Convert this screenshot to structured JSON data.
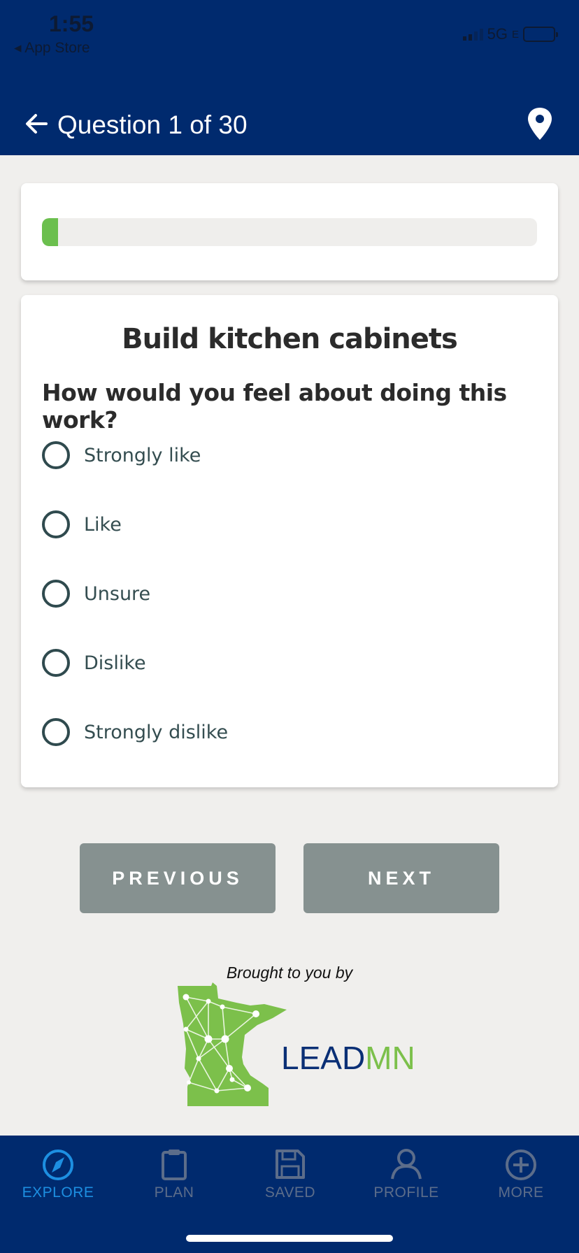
{
  "status_bar": {
    "time": "1:55",
    "back_app": "App Store",
    "network": "5G",
    "network_suffix": "E"
  },
  "header": {
    "title": "Question 1 of 30",
    "back_icon": "arrow-left-icon",
    "location_icon": "map-pin-icon"
  },
  "progress": {
    "value": 0.033
  },
  "question": {
    "title": "Build kitchen cabinets",
    "prompt": "How would you feel about doing this work?",
    "options": [
      "Strongly like",
      "Like",
      "Unsure",
      "Dislike",
      "Strongly dislike"
    ]
  },
  "nav": {
    "previous": "PREVIOUS",
    "next": "NEXT"
  },
  "sponsor": {
    "brought_by": "Brought to you by",
    "lead": "LEAD",
    "mn": "MN"
  },
  "tabs": [
    {
      "label": "EXPLORE",
      "icon": "compass-icon",
      "active": true
    },
    {
      "label": "PLAN",
      "icon": "clipboard-icon",
      "active": false
    },
    {
      "label": "SAVED",
      "icon": "floppy-disk-icon",
      "active": false
    },
    {
      "label": "PROFILE",
      "icon": "person-icon",
      "active": false
    },
    {
      "label": "MORE",
      "icon": "plus-circle-icon",
      "active": false
    }
  ],
  "colors": {
    "header_bg": "#002a6e",
    "accent_green": "#6bbf4e",
    "button_grey": "#869190",
    "active_tab": "#1d8fe1"
  }
}
